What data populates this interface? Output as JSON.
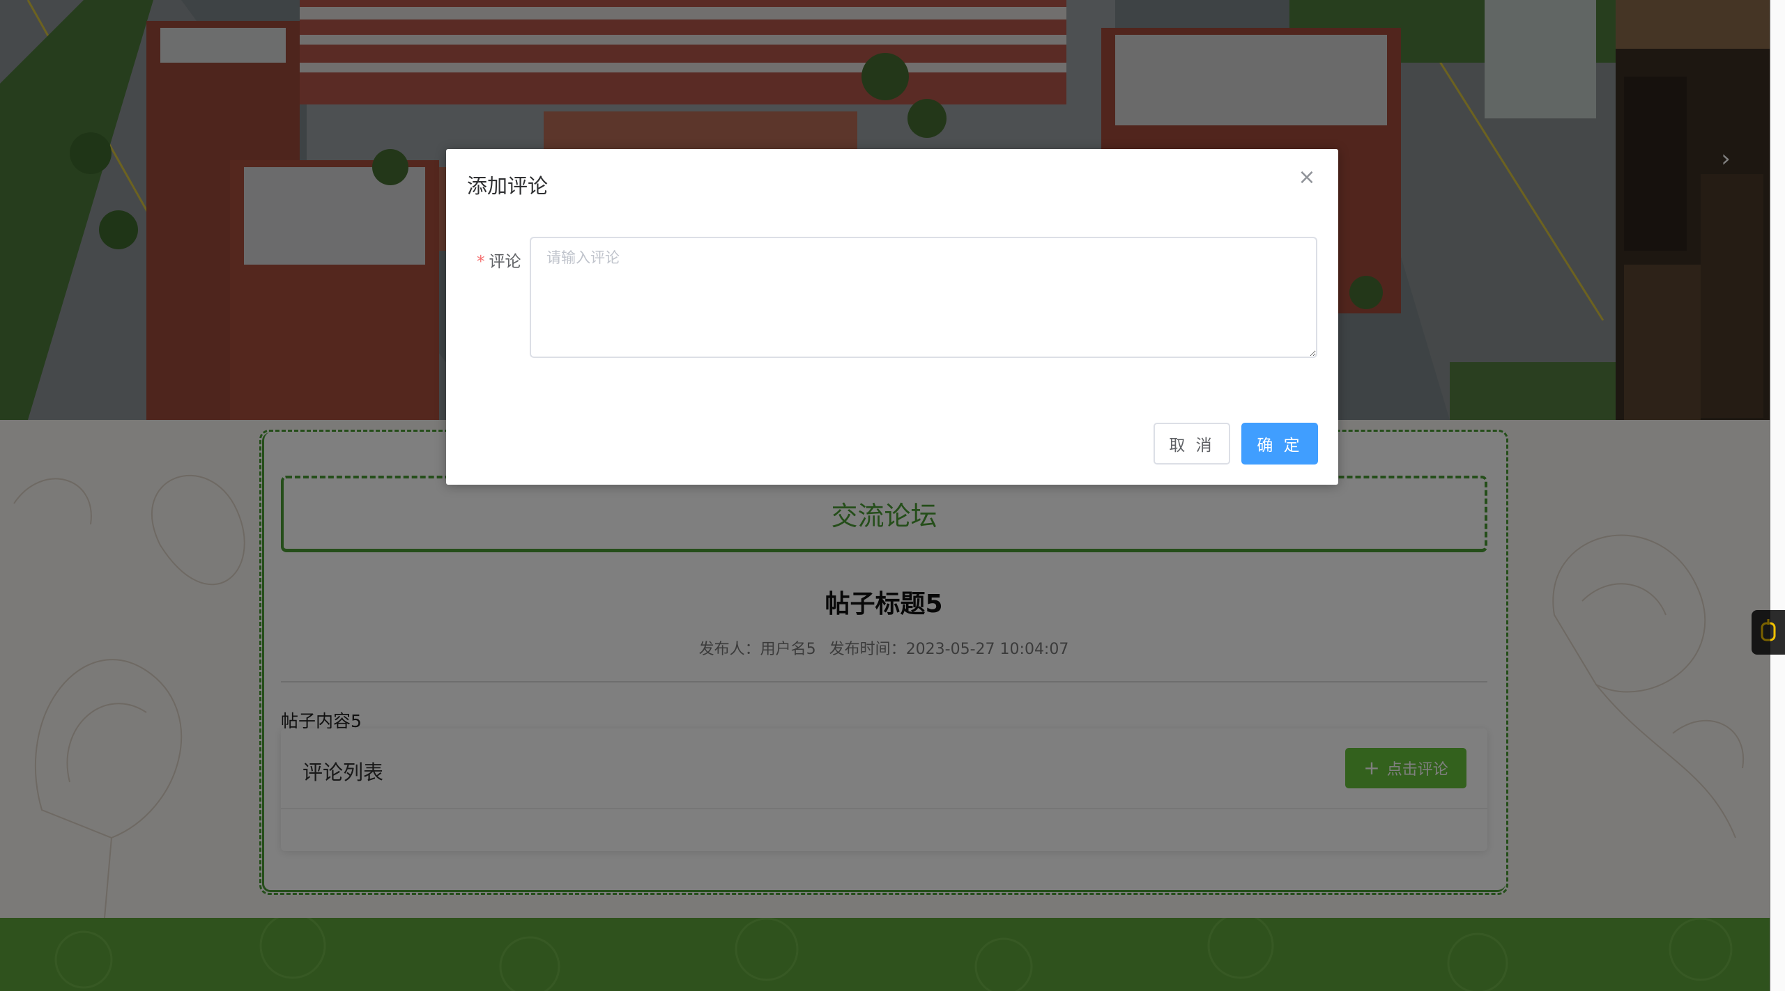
{
  "banner": {
    "next_icon": "chevron-right-icon"
  },
  "forum": {
    "header": "交流论坛"
  },
  "post": {
    "title": "帖子标题5",
    "author_label": "发布人：",
    "author": "用户名5",
    "time_label": "发布时间：",
    "time": "2023-05-27 10:04:07",
    "body": "帖子内容5"
  },
  "comments": {
    "title": "评论列表",
    "add_button": "点击评论",
    "add_icon": "plus-icon"
  },
  "dialog": {
    "title": "添加评论",
    "close_icon": "close-icon",
    "field_required_mark": "*",
    "field_label": "评论",
    "field_placeholder": "请输入评论",
    "field_value": "",
    "cancel_label": "取 消",
    "ok_label": "确 定"
  },
  "colors": {
    "accent_green": "#4a9d35",
    "button_green": "#67c23a",
    "primary_blue": "#409eff",
    "footer_green": "#5ea53a"
  },
  "side_tool_icon": "cup-icon"
}
